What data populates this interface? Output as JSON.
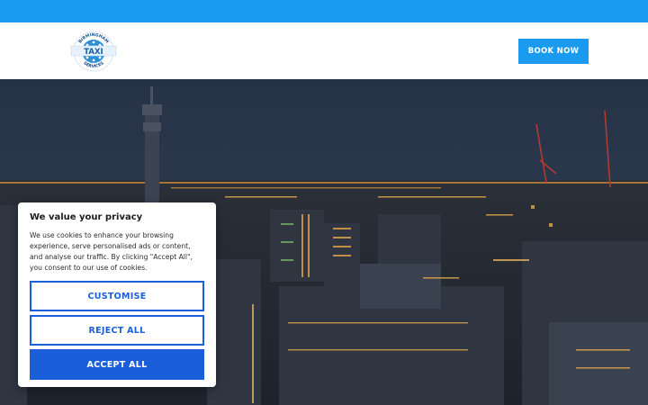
{
  "header": {
    "logo": {
      "icon": "taxi-badge-logo",
      "top_text": "BIRMINGHAM",
      "center_text": "TAXI",
      "bottom_text": "SERVICES"
    },
    "book_label": "BOOK NOW"
  },
  "cookie_banner": {
    "title": "We value your privacy",
    "body": "We use cookies to enhance your browsing experience, serve personalised ads or content, and analyse our traffic. By clicking \"Accept All\", you consent to our use of cookies.",
    "customise_label": "CUSTOMISE",
    "reject_label": "REJECT ALL",
    "accept_label": "ACCEPT ALL"
  },
  "colors": {
    "brand_blue": "#1a9bf0",
    "cookie_button_blue": "#1a5fd9",
    "hero_overlay": "#1c2638"
  }
}
